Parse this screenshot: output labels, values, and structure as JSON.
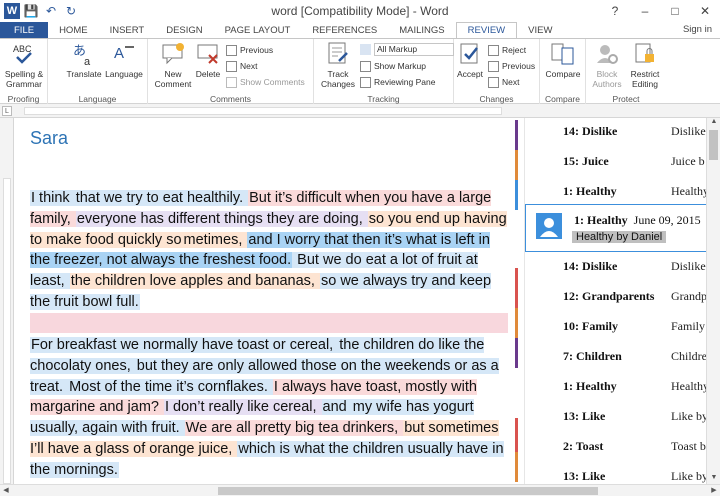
{
  "window": {
    "title": "word [Compatibility Mode] - Word",
    "logo": "W",
    "help": "?",
    "minimize": "–",
    "maximize": "□",
    "close": "✕",
    "signin": "Sign in"
  },
  "qat": {
    "save_icon": "💾",
    "undo_icon": "↶",
    "redo_icon": "↻"
  },
  "tabs": [
    "FILE",
    "HOME",
    "INSERT",
    "DESIGN",
    "PAGE LAYOUT",
    "REFERENCES",
    "MAILINGS",
    "REVIEW",
    "VIEW"
  ],
  "ribbon": {
    "proofing": {
      "label": "Proofing",
      "spelling": "Spelling &\nGrammar",
      "abc": "ABC"
    },
    "language": {
      "label": "Language",
      "translate": "Translate",
      "language": "Language"
    },
    "comments": {
      "label": "Comments",
      "new": "New\nComment",
      "delete": "Delete",
      "previous": "Previous",
      "next": "Next",
      "show": "Show Comments"
    },
    "tracking": {
      "label": "Tracking",
      "track": "Track\nChanges",
      "markup": "All Markup",
      "show_markup": "Show Markup",
      "reviewing_pane": "Reviewing Pane"
    },
    "changes": {
      "label": "Changes",
      "accept": "Accept",
      "reject": "Reject",
      "previous": "Previous",
      "next": "Next"
    },
    "compare": {
      "label": "Compare",
      "compare": "Compare"
    },
    "protect": {
      "label": "Protect",
      "block": "Block\nAuthors",
      "restrict": "Restrict\nEditing"
    }
  },
  "ruler": {
    "corner": "L"
  },
  "document": {
    "name": "Sara",
    "para1": [
      {
        "t": "I think ",
        "c": "c1"
      },
      {
        "t": "that we try to eat healthily. ",
        "c": "c1"
      },
      {
        "t": "But it’s difficult when you have a large family, ",
        "c": "c2"
      },
      {
        "t": "everyone has different things they are doing, ",
        "c": "c4"
      },
      {
        "t": "so you end up having to make food quickly so",
        "c": "c3"
      },
      {
        "t": "metimes, ",
        "c": "c3"
      },
      {
        "t": "and I worry that then it’s what is left in the freezer, not always the freshest food.",
        "c": "c5"
      },
      {
        "t": " But we do eat a lot of fruit at least, ",
        "c": "c1"
      },
      {
        "t": "the children love apples and bananas, ",
        "c": "c3"
      },
      {
        "t": "so we always try and keep the fruit bowl full.",
        "c": "c1"
      }
    ],
    "para2": [
      {
        "t": "For breakfast we normally have toast or cereal, ",
        "c": "c1"
      },
      {
        "t": "the children do like the chocolaty ones, ",
        "c": "c1"
      },
      {
        "t": "but they are only allowed those on the weekends or as a treat. ",
        "c": "c1"
      },
      {
        "t": "Most of the time it’s cornflakes. ",
        "c": "c1"
      },
      {
        "t": "I always have toast, mostly with margarine and jam? ",
        "c": "c2"
      },
      {
        "t": "I don’t really like cereal, ",
        "c": "c4"
      },
      {
        "t": "and ",
        "c": "c1"
      },
      {
        "t": "my wife has yogurt usually, again with fruit. ",
        "c": "c1"
      },
      {
        "t": "We are all pretty big tea drinkers, ",
        "c": "c2"
      },
      {
        "t": "but sometimes I’ll have a glass of orange juice, ",
        "c": "c3"
      },
      {
        "t": "which is what the children usually have in the mornings.",
        "c": "c1"
      }
    ]
  },
  "comments": [
    {
      "key": "14: Dislike",
      "val": "Dislike"
    },
    {
      "key": "15: Juice",
      "val": "Juice b"
    },
    {
      "key": "1: Healthy",
      "val": "Healthy"
    },
    {
      "key": "14: Dislike",
      "val": "Dislike"
    },
    {
      "key": "12: Grandparents",
      "val": "Grandpa"
    },
    {
      "key": "10: Family",
      "val": "Family"
    },
    {
      "key": "7: Children",
      "val": "Children"
    },
    {
      "key": "1: Healthy",
      "val": "Healthy"
    },
    {
      "key": "13: Like",
      "val": "Like by"
    },
    {
      "key": "2: Toast",
      "val": "Toast b"
    },
    {
      "key": "13: Like",
      "val": "Like by"
    }
  ],
  "active_comment": {
    "key": "1: Healthy",
    "date": "June 09, 2015",
    "body": "Healthy by Daniel"
  },
  "colors": {
    "accent": "#2b579a",
    "blue": "#3c8fdc"
  }
}
